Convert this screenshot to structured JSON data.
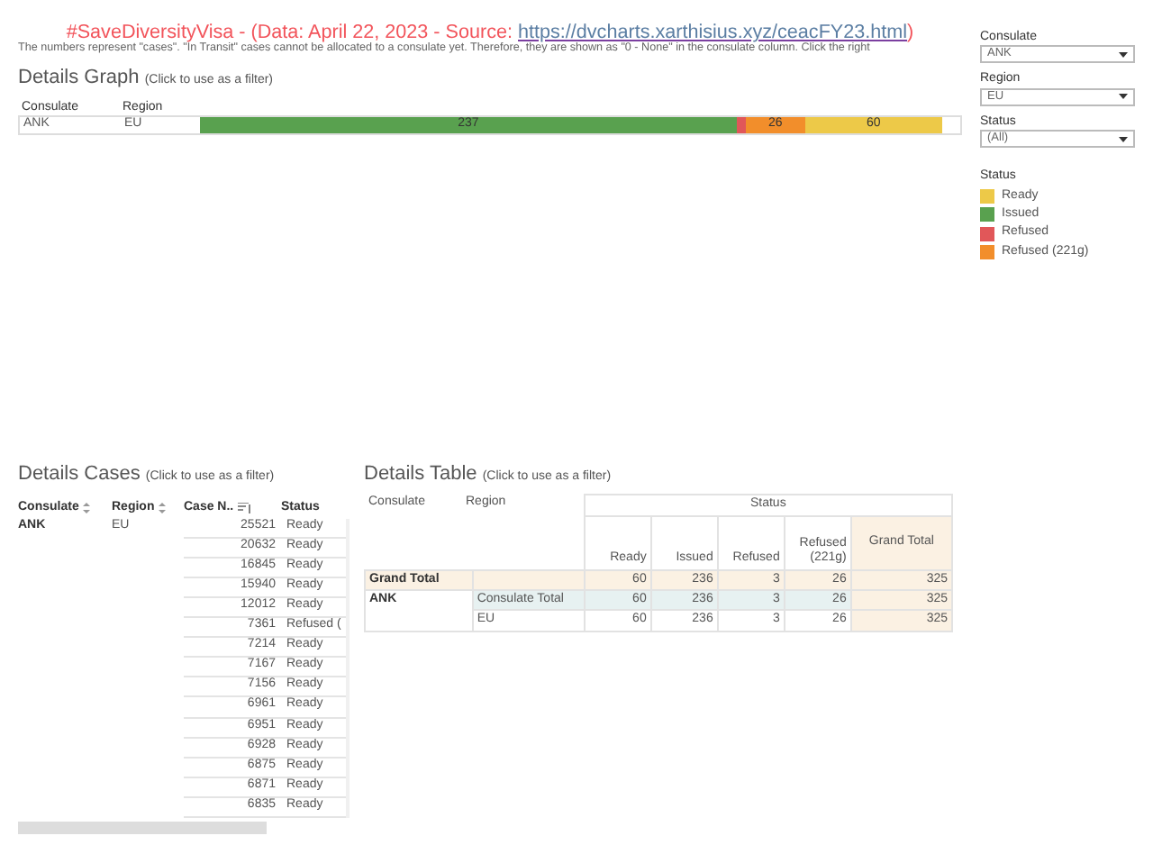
{
  "header": {
    "title_prefix": "#SaveDiversityVisa - (Data: April 22, 2023 - Source: ",
    "link": "https://dvcharts.xarthisius.xyz/ceacFY23.html",
    "title_suffix": ")",
    "note": "The numbers represent \"cases\". \"In Transit\" cases cannot be allocated to a consulate yet. Therefore, they are shown as \"0 - None\" in the consulate column. Click the right"
  },
  "details_graph": {
    "title": "Details Graph",
    "hint": "(Click to use as a filter)",
    "columns": [
      "Consulate",
      "Region"
    ],
    "row": {
      "consulate": "ANK",
      "region": "EU"
    },
    "segments": [
      {
        "color": "#59a14f",
        "label": "237"
      },
      {
        "color": "#e15759"
      },
      {
        "color": "#f28e2b",
        "label": "26"
      },
      {
        "color": "#edc948",
        "label": "60"
      }
    ]
  },
  "filters": [
    {
      "label": "Consulate",
      "value": "ANK"
    },
    {
      "label": "Region",
      "value": "EU"
    },
    {
      "label": "Status",
      "value": "(All)"
    }
  ],
  "legend": {
    "title": "Status",
    "items": [
      {
        "label": "Ready",
        "color": "#edc948"
      },
      {
        "label": "Issued",
        "color": "#59a14f"
      },
      {
        "label": "Refused",
        "color": "#e15759"
      },
      {
        "label": "Refused (221g)",
        "color": "#f28e2b"
      }
    ]
  },
  "details_cases": {
    "title": "Details Cases",
    "hint": "(Click to use as a filter)",
    "columns": [
      {
        "label": "Consulate",
        "kind": "toggle"
      },
      {
        "label": "Region",
        "kind": "toggle"
      },
      {
        "label": "Case N..",
        "kind": "sorted"
      },
      {
        "label": "Status",
        "kind": "none"
      }
    ],
    "consulate": "ANK",
    "region": "EU",
    "rows": [
      {
        "case": "25521",
        "status": "Ready"
      },
      {
        "case": "20632",
        "status": "Ready"
      },
      {
        "case": "16845",
        "status": "Ready"
      },
      {
        "case": "15940",
        "status": "Ready"
      },
      {
        "case": "12012",
        "status": "Ready"
      },
      {
        "case": "7361",
        "status": "Refused ("
      },
      {
        "case": "7214",
        "status": "Ready"
      },
      {
        "case": "7167",
        "status": "Ready"
      },
      {
        "case": "7156",
        "status": "Ready"
      },
      {
        "case": "6961",
        "status": "Ready"
      },
      {
        "case": "6951",
        "status": "Ready"
      },
      {
        "case": "6928",
        "status": "Ready"
      },
      {
        "case": "6875",
        "status": "Ready"
      },
      {
        "case": "6871",
        "status": "Ready"
      },
      {
        "case": "6835",
        "status": "Ready"
      }
    ]
  },
  "details_table": {
    "title": "Details Table",
    "hint": "(Click to use as a filter)",
    "group_header": "Status",
    "columns": [
      "Consulate",
      "Region",
      "Ready",
      "Issued",
      "Refused",
      "Refused (221g)",
      "Grand Total"
    ],
    "rows": [
      {
        "kind": "grand_total",
        "consulate": "Grand Total",
        "region": "",
        "values": [
          "60",
          "236",
          "3",
          "26",
          "325"
        ]
      },
      {
        "kind": "subtotal",
        "consulate": "ANK",
        "region": "Consulate Total",
        "values": [
          "60",
          "236",
          "3",
          "26",
          "325"
        ]
      },
      {
        "kind": "detail",
        "consulate": "",
        "region": "EU",
        "values": [
          "60",
          "236",
          "3",
          "26",
          "325"
        ]
      }
    ]
  }
}
